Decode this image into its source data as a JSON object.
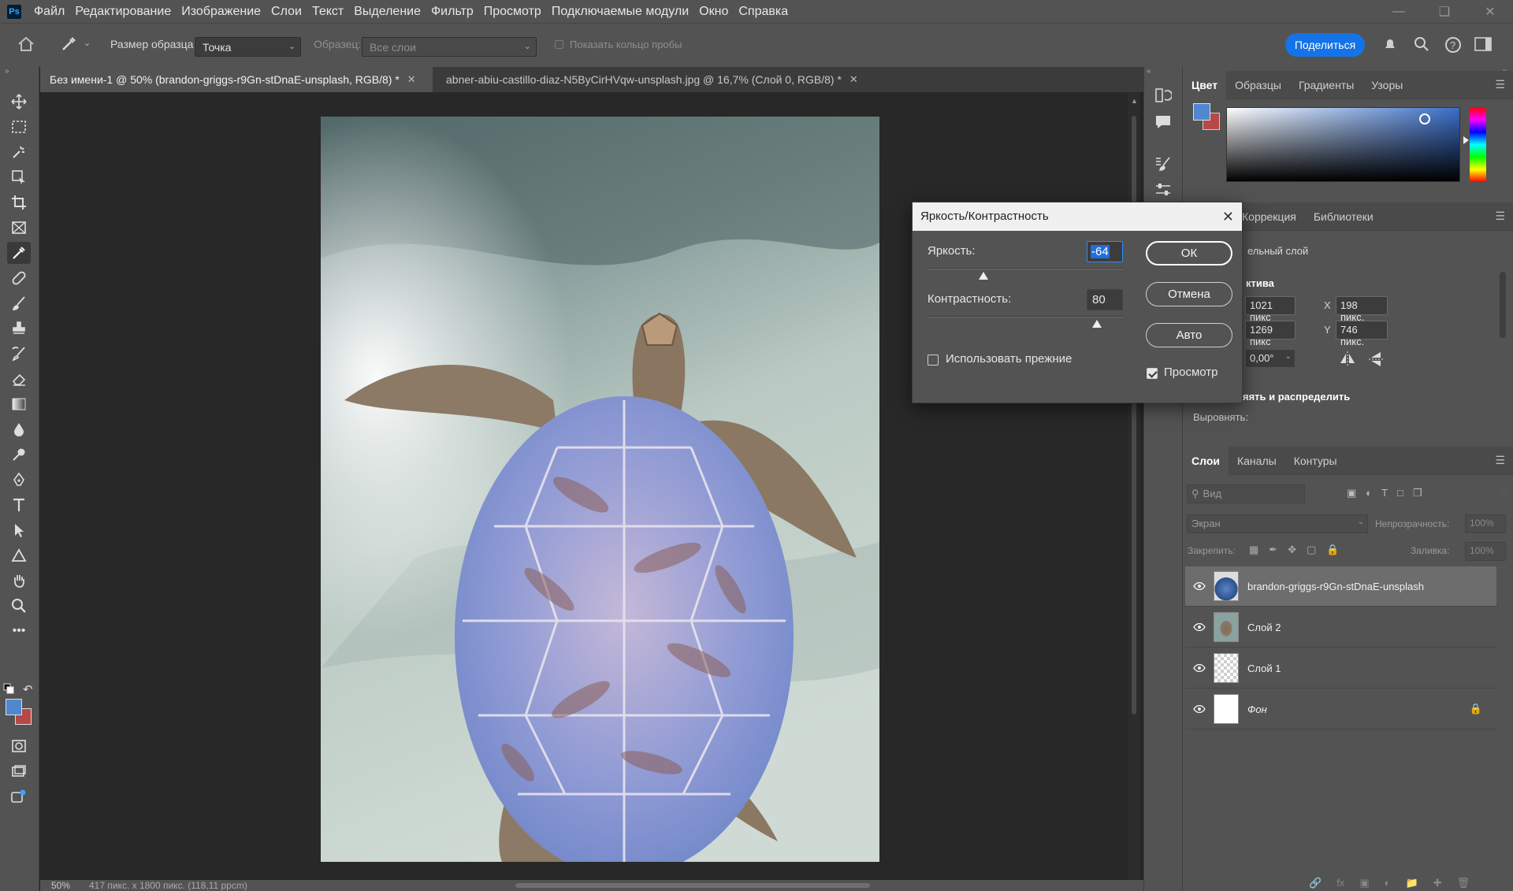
{
  "menu": [
    "Файл",
    "Редактирование",
    "Изображение",
    "Слои",
    "Текст",
    "Выделение",
    "Фильтр",
    "Просмотр",
    "Подключаемые модули",
    "Окно",
    "Справка"
  ],
  "options": {
    "sample_size_label": "Размер образца:",
    "sample_size_value": "Точка",
    "sample_label": "Образец:",
    "sample_value": "Все слои",
    "show_ring_label": "Показать кольцо пробы",
    "share_label": "Поделиться"
  },
  "tabs": [
    {
      "label": "Без имени-1 @ 50% (brandon-griggs-r9Gn-stDnaE-unsplash, RGB/8) *",
      "active": true
    },
    {
      "label": "abner-abiu-castillo-diaz-N5ByCirHVqw-unsplash.jpg @ 16,7% (Слой 0, RGB/8) *",
      "active": false
    }
  ],
  "status": {
    "zoom": "50%",
    "info": "417 пикс. х 1800 пикс. (118,11 ppcm)"
  },
  "color_panel": {
    "tabs": [
      "Цвет",
      "Образцы",
      "Градиенты",
      "Узоры"
    ],
    "fg": "#4f88cf",
    "bg": "#b64848"
  },
  "props_panel": {
    "tabs": [
      "Коррекция",
      "Библиотеки"
    ],
    "layer_type": "ельный слой",
    "section": "ктива",
    "w": "1021 пикс",
    "h": "1269 пикс",
    "x_label": "X",
    "x": "198 пикс.",
    "y_label": "Y",
    "y": "746 пикс.",
    "angle": "0,00°",
    "align_section": "яять и распределить",
    "align_label": "Выровнять:"
  },
  "layers_panel": {
    "tabs": [
      "Слои",
      "Каналы",
      "Контуры"
    ],
    "search_placeholder": "Вид",
    "blend_mode": "Экран",
    "opacity_label": "Непрозрачность:",
    "opacity": "100%",
    "lock_label": "Закрепить:",
    "fill_label": "Заливка:",
    "fill": "100%",
    "layers": [
      {
        "name": "brandon-griggs-r9Gn-stDnaE-unsplash",
        "selected": true,
        "italic": false
      },
      {
        "name": "Слой 2",
        "selected": false,
        "italic": false
      },
      {
        "name": "Слой 1",
        "selected": false,
        "italic": false
      },
      {
        "name": "Фон",
        "selected": false,
        "italic": true
      }
    ]
  },
  "dialog": {
    "title": "Яркость/Контрастность",
    "brightness_label": "Яркость:",
    "brightness": "-64",
    "brightness_value": -64,
    "contrast_label": "Контрастность:",
    "contrast": "80",
    "contrast_value": 80,
    "ok": "ОК",
    "cancel": "Отмена",
    "auto": "Авто",
    "legacy_label": "Использовать прежние",
    "preview_label": "Просмотр"
  }
}
